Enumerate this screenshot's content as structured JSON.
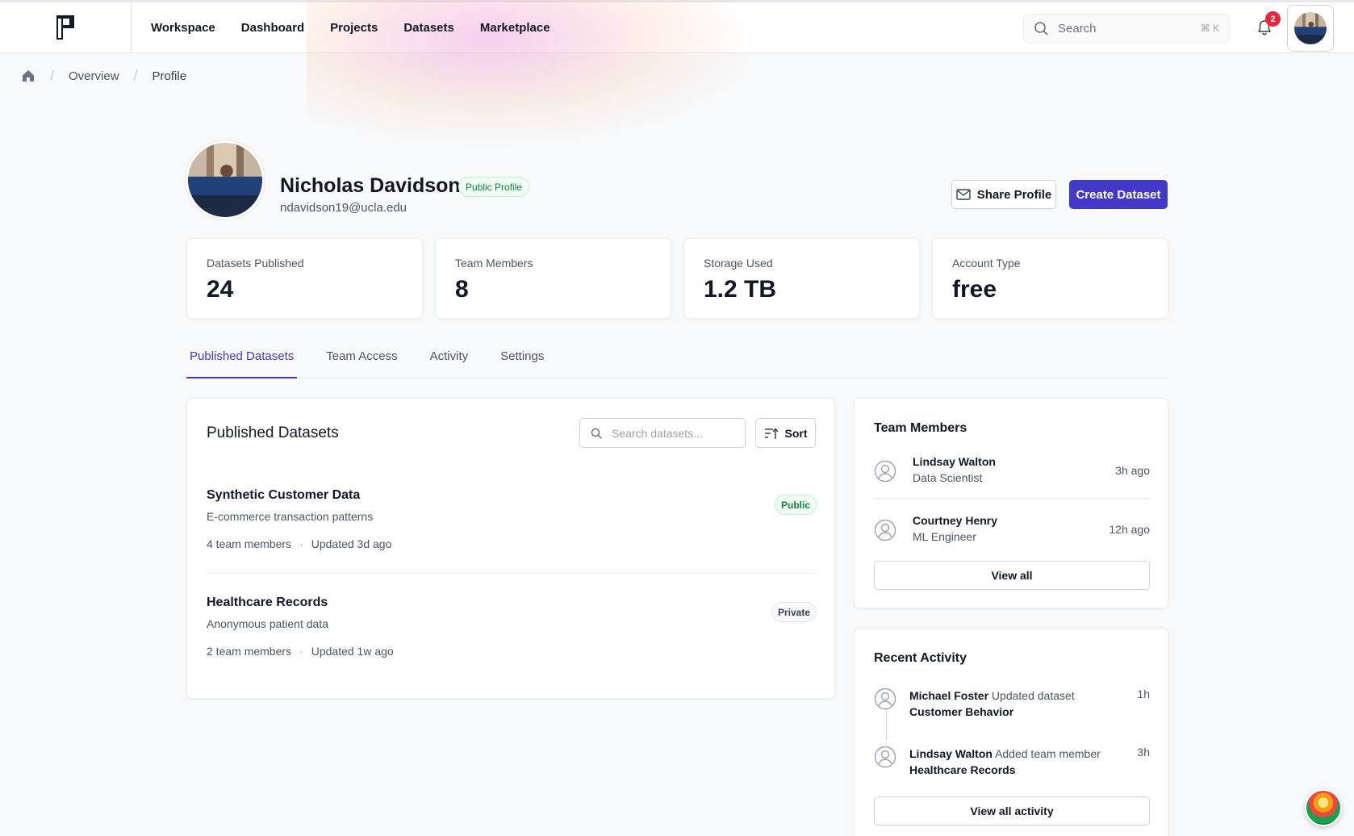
{
  "nav": {
    "items": [
      "Workspace",
      "Dashboard",
      "Projects",
      "Datasets",
      "Marketplace"
    ],
    "search_placeholder": "Search",
    "search_shortcut": "⌘ K",
    "notification_count": "2"
  },
  "breadcrumb": {
    "items": [
      "Overview",
      "Profile"
    ]
  },
  "profile": {
    "name": "Nicholas Davidson",
    "visibility_badge": "Public Profile",
    "email": "ndavidson19@ucla.edu",
    "share_label": "Share Profile",
    "create_label": "Create Dataset"
  },
  "stats": [
    {
      "label": "Datasets Published",
      "value": "24"
    },
    {
      "label": "Team Members",
      "value": "8"
    },
    {
      "label": "Storage Used",
      "value": "1.2 TB"
    },
    {
      "label": "Account Type",
      "value": "free"
    }
  ],
  "tabs": [
    "Published Datasets",
    "Team Access",
    "Activity",
    "Settings"
  ],
  "active_tab": "Published Datasets",
  "datasets_panel": {
    "title": "Published Datasets",
    "search_placeholder": "Search datasets...",
    "sort_label": "Sort",
    "items": [
      {
        "name": "Synthetic Customer Data",
        "description": "E-commerce transaction patterns",
        "members": "4 team members",
        "updated": "Updated 3d ago",
        "tag": "Public"
      },
      {
        "name": "Healthcare Records",
        "description": "Anonymous patient data",
        "members": "2 team members",
        "updated": "Updated 1w ago",
        "tag": "Private"
      }
    ]
  },
  "team_panel": {
    "title": "Team Members",
    "members": [
      {
        "name": "Lindsay Walton",
        "role": "Data Scientist",
        "time": "3h ago"
      },
      {
        "name": "Courtney Henry",
        "role": "ML Engineer",
        "time": "12h ago"
      }
    ],
    "view_all_label": "View all"
  },
  "activity_panel": {
    "title": "Recent Activity",
    "items": [
      {
        "actor": "Michael Foster",
        "action": "Updated dataset",
        "target": "Customer Behavior",
        "time": "1h"
      },
      {
        "actor": "Lindsay Walton",
        "action": "Added team member",
        "target": "Healthcare Records",
        "time": "3h"
      }
    ],
    "view_all_label": "View all activity"
  },
  "colors": {
    "accent": "#4338ca",
    "public_green": "#15803d",
    "badge_red": "#ef233c"
  }
}
